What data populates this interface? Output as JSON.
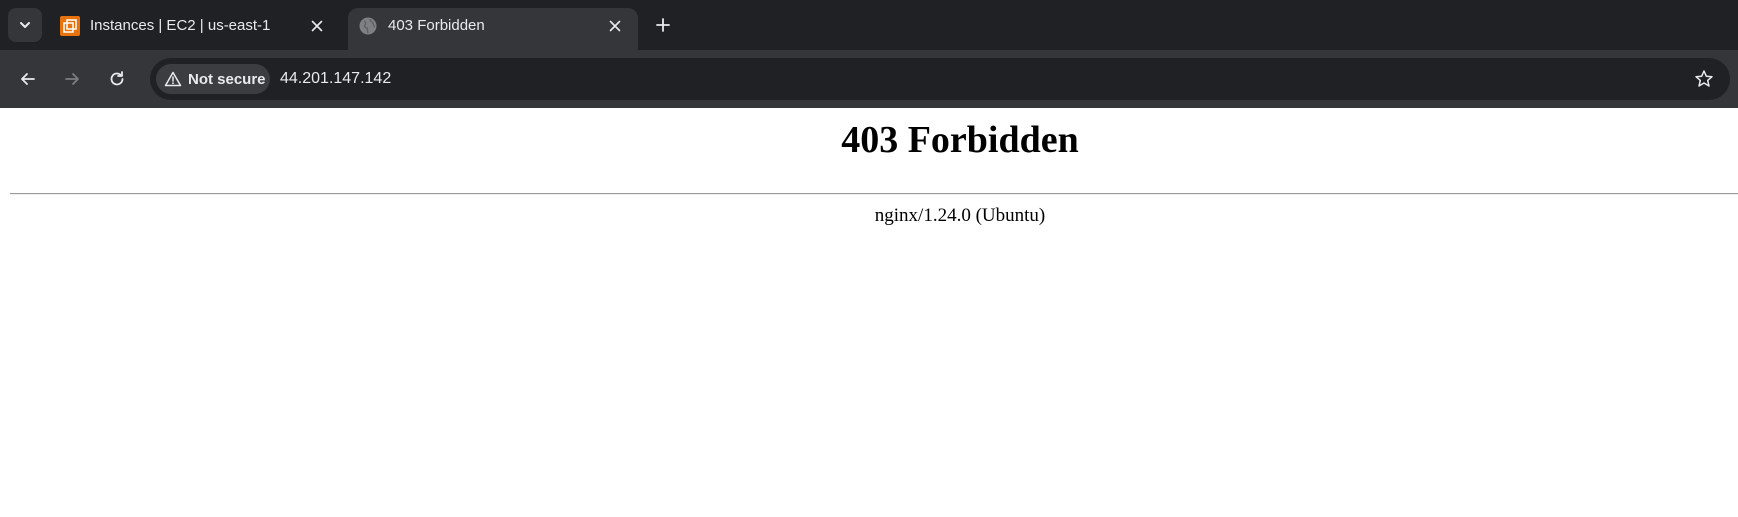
{
  "browser": {
    "tabs": [
      {
        "title": "Instances | EC2 | us-east-1",
        "favicon": "aws-ec2-icon",
        "active": false
      },
      {
        "title": "403 Forbidden",
        "favicon": "globe-icon",
        "active": true
      }
    ],
    "address_bar": {
      "security_label": "Not secure",
      "url": "44.201.147.142"
    },
    "icons": {
      "tab_search": "chevron-down-icon",
      "close": "close-icon",
      "new_tab": "plus-icon",
      "back": "arrow-left-icon",
      "forward": "arrow-right-icon",
      "reload": "reload-icon",
      "security": "warning-icon",
      "bookmark": "star-icon"
    },
    "colors": {
      "tabstrip": "#202124",
      "toolbar": "#35363a",
      "ec2_favicon": "#e8720c"
    }
  },
  "page": {
    "heading": "403 Forbidden",
    "server_signature": "nginx/1.24.0 (Ubuntu)"
  }
}
